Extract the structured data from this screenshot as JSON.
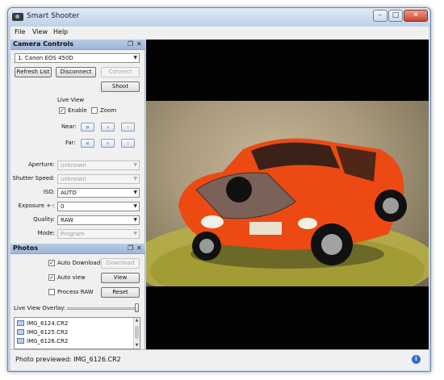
{
  "window": {
    "title": "Smart Shooter",
    "min_label": "–",
    "max_label": "□",
    "close_label": "✕"
  },
  "menu": [
    "File",
    "View",
    "Help"
  ],
  "camera_controls": {
    "title": "Camera Controls",
    "pin": "❐",
    "close": "✕",
    "camera_select": "1. Canon EOS 450D",
    "refresh_label": "Refresh List",
    "disconnect_label": "Disconnect",
    "connect_label": "Connect",
    "shoot_label": "Shoot",
    "live_view": {
      "heading": "Live View",
      "enable_label": "Enable",
      "enable_checked": true,
      "zoom_label": "Zoom",
      "zoom_checked": false,
      "near_label": "Near:",
      "far_label": "Far:",
      "near_icons": [
        "fast-right-arrow-icon",
        "right-arrow-icon",
        "small-right-arrow-icon"
      ],
      "far_icons": [
        "fast-left-arrow-icon",
        "left-arrow-icon",
        "small-left-arrow-icon"
      ]
    },
    "settings": [
      {
        "label": "Aperture:",
        "value": "unknown",
        "enabled": false
      },
      {
        "label": "Shutter Speed:",
        "value": "unknown",
        "enabled": false
      },
      {
        "label": "ISO:",
        "value": "AUTO",
        "enabled": true
      },
      {
        "label": "Exposure +-:",
        "value": "0",
        "enabled": true
      },
      {
        "label": "Quality:",
        "value": "RAW",
        "enabled": true
      },
      {
        "label": "Mode:",
        "value": "Program",
        "enabled": false
      }
    ]
  },
  "photos": {
    "title": "Photos",
    "pin": "❐",
    "close": "✕",
    "auto_download_label": "Auto Download",
    "auto_download_checked": true,
    "download_label": "Download",
    "auto_view_label": "Auto view",
    "auto_view_checked": true,
    "view_label": "View",
    "process_raw_label": "Process RAW",
    "process_raw_checked": false,
    "reset_label": "Reset",
    "overlay_label": "Live View Overlay:",
    "overlay_level": 1.0,
    "files": [
      "IMG_6124.CR2",
      "IMG_6125.CR2",
      "IMG_6126.CR2"
    ]
  },
  "status": {
    "text": "Photo previewed: IMG_6126.CR2",
    "info_icon": "i"
  },
  "colors": {
    "panel_header": "#a9bfdf",
    "car_body": "#ec4a12",
    "accent_blue": "#2f6fcf"
  }
}
